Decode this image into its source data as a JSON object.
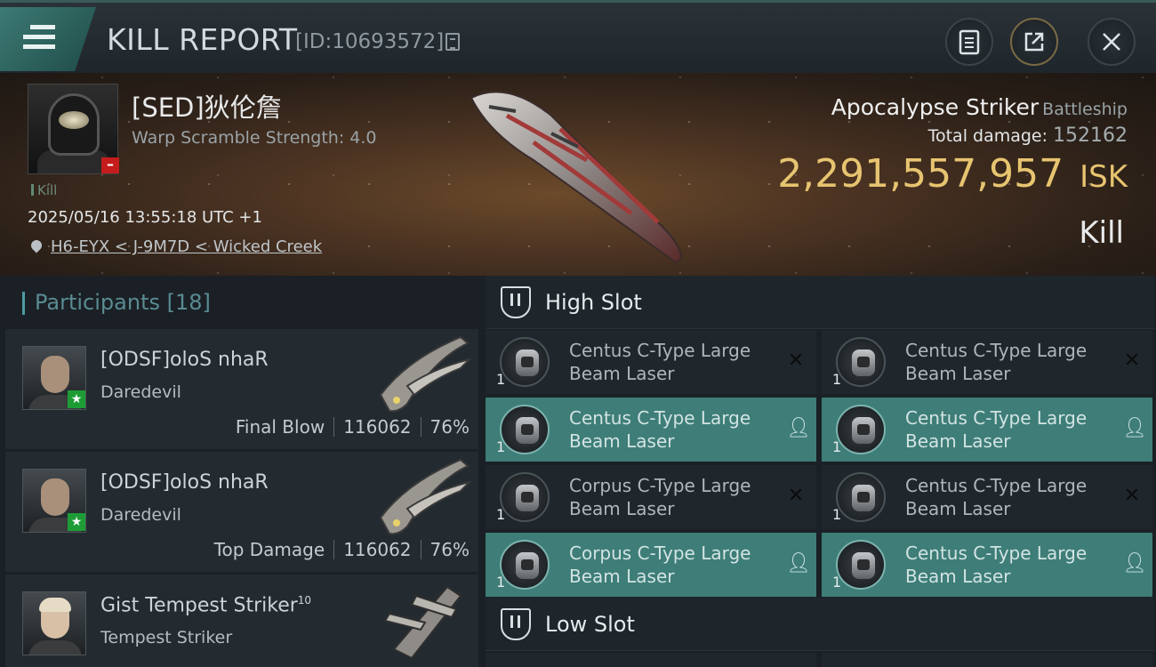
{
  "header": {
    "title": "KILL REPORT",
    "kill_id": "[ID:10693572]"
  },
  "victim": {
    "name": "[SED]狄伦詹",
    "warp_scramble": "Warp Scramble Strength: 4.0",
    "tag": "Kill",
    "datetime": "2025/05/16 13:55:18 UTC +1",
    "location": "H6-EYX < J-9M7D < Wicked Creek",
    "ship": "Apocalypse Striker",
    "ship_class": "Battleship",
    "total_damage_label": "Total damage:",
    "total_damage": "152162",
    "isk_value": "2,291,557,957",
    "isk_unit": "ISK",
    "result": "Kill"
  },
  "participants": {
    "label": "Participants",
    "count": "[18]",
    "items": [
      {
        "name": "[ODSF]oloS nhaR",
        "ship": "Daredevil",
        "role": "Final Blow",
        "damage": "116062",
        "percent": "76%"
      },
      {
        "name": "[ODSF]oloS nhaR",
        "ship": "Daredevil",
        "role": "Top Damage",
        "damage": "116062",
        "percent": "76%"
      },
      {
        "name": "Gist Tempest Striker",
        "name_sup": "10",
        "ship": "Tempest Striker"
      }
    ]
  },
  "slots": {
    "high_title": "High Slot",
    "low_title": "Low Slot",
    "high_modules": [
      {
        "line1": "Centus C-Type Large",
        "line2": "Beam Laser",
        "qty": "1",
        "flag": "destroyed-x-icon"
      },
      {
        "line1": "Centus C-Type Large",
        "line2": "Beam Laser",
        "qty": "1",
        "flag": "destroyed-x-icon"
      },
      {
        "line1": "Centus C-Type Large",
        "line2": "Beam Laser",
        "qty": "1",
        "flag": "dropped-person-icon"
      },
      {
        "line1": "Centus C-Type Large",
        "line2": "Beam Laser",
        "qty": "1",
        "flag": "dropped-person-icon"
      },
      {
        "line1": "Corpus C-Type Large",
        "line2": "Beam Laser",
        "qty": "1",
        "flag": "destroyed-x-icon"
      },
      {
        "line1": "Centus C-Type Large",
        "line2": "Beam Laser",
        "qty": "1",
        "flag": "destroyed-x-icon"
      },
      {
        "line1": "Corpus C-Type Large",
        "line2": "Beam Laser",
        "qty": "1",
        "flag": "dropped-person-icon"
      },
      {
        "line1": "Centus C-Type Large",
        "line2": "Beam Laser",
        "qty": "1",
        "flag": "dropped-person-icon"
      }
    ]
  },
  "colors": {
    "accent": "#3e7d78",
    "isk": "#e7c470",
    "badge_red": "#c51c1c",
    "badge_green": "#1d9c36"
  }
}
